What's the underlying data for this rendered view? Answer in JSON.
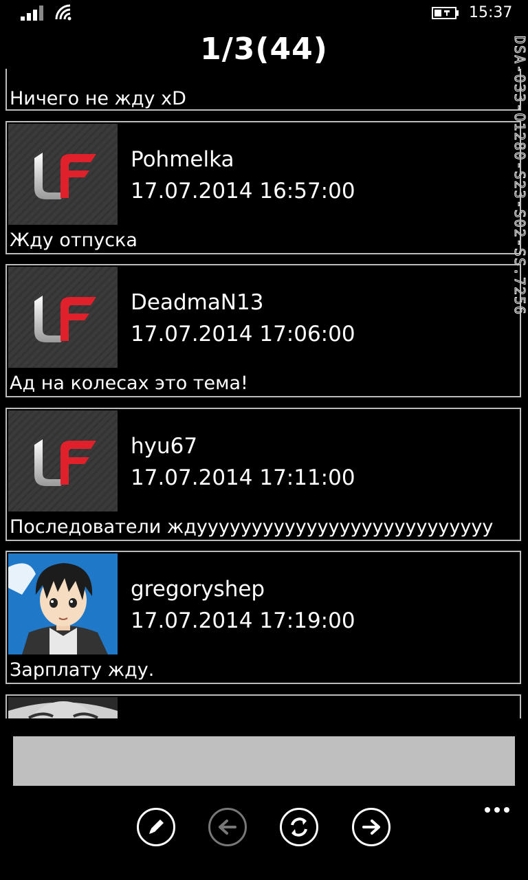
{
  "status_bar": {
    "time": "15:37",
    "icons": [
      "signal-icon",
      "wifi-icon",
      "battery-charging-icon"
    ]
  },
  "header": {
    "title": "1/3(44)"
  },
  "debug_strip": {
    "text": "DSA-O33-O1280-S23-S02-SS.7256"
  },
  "posts": [
    {
      "author": "",
      "date": "",
      "message": "Ничего не жду xD",
      "avatar": ""
    },
    {
      "author": "Pohmelka",
      "date": "17.07.2014 16:57:00",
      "message": "Жду отпуска",
      "avatar": "lf-logo"
    },
    {
      "author": "DeadmaN13",
      "date": "17.07.2014 17:06:00",
      "message": "Ад на колесах это тема!",
      "avatar": "lf-logo"
    },
    {
      "author": "hyu67",
      "date": "17.07.2014 17:11:00",
      "message": "Последователи ждууууууууууууууууууууууууууу",
      "avatar": "lf-logo"
    },
    {
      "author": "gregoryshep",
      "date": "17.07.2014 17:19:00",
      "message": "Зарплату жду.",
      "avatar": "anime-character"
    },
    {
      "author": "",
      "date": "",
      "message": "",
      "avatar": "grayscale-face"
    }
  ],
  "compose": {
    "value": "",
    "placeholder": ""
  },
  "app_bar": {
    "buttons": [
      {
        "icon": "pencil-icon",
        "enabled": true
      },
      {
        "icon": "arrow-left-icon",
        "enabled": false
      },
      {
        "icon": "refresh-icon",
        "enabled": true
      },
      {
        "icon": "arrow-right-icon",
        "enabled": true
      }
    ],
    "more_icon": "ellipsis-icon"
  },
  "colors": {
    "background": "#000000",
    "border": "#bdbdbd",
    "input": "#bfbfbf",
    "logo_red": "#e0202a"
  }
}
